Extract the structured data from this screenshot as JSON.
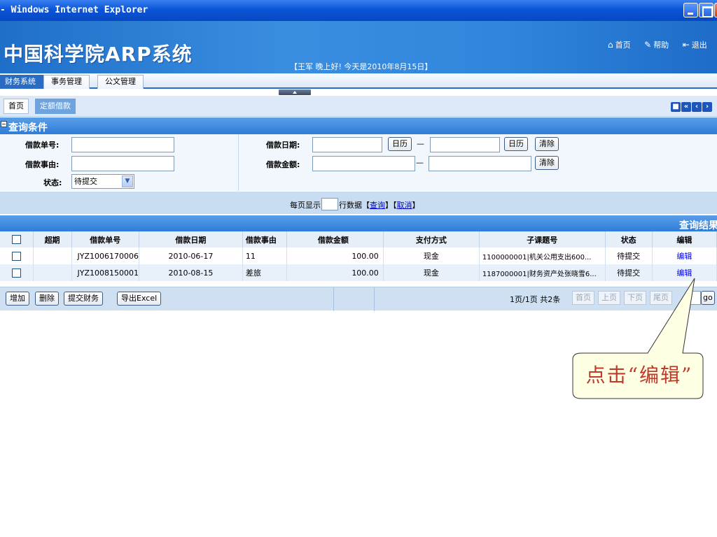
{
  "window": {
    "title": "- Windows Internet Explorer"
  },
  "banner": {
    "logo": "中国科学院ARP系统",
    "greeting": "【王军 晚上好! 今天是2010年8月15日】",
    "links": [
      {
        "icon": "home-icon",
        "glyph": "⌂",
        "label": "首页"
      },
      {
        "icon": "help-icon",
        "glyph": "✎",
        "label": "帮助"
      },
      {
        "icon": "logout-icon",
        "glyph": "⇤",
        "label": "退出"
      }
    ]
  },
  "menu": {
    "tabs": [
      "财务系统",
      "事务管理",
      "公文管理"
    ],
    "active": 0
  },
  "page_tabs": {
    "home": "首页",
    "current": "定额借款"
  },
  "query": {
    "section_title": "查询条件",
    "loan_no_label": "借款单号:",
    "loan_reason_label": "借款事由:",
    "status_label": "状态:",
    "status_value": "待提交",
    "loan_date_label": "借款日期:",
    "loan_amount_label": "借款金额:",
    "calendar_btn": "日历",
    "clear_btn": "清除",
    "range_sep": "—"
  },
  "paging": {
    "prefix": "每页显示",
    "suffix": "行数据【",
    "query_link": "查询",
    "mid": "】【",
    "cancel_link": "取消",
    "end": "】"
  },
  "results": {
    "section_title": "查询结果",
    "columns": [
      "",
      "超期",
      "借款单号",
      "借款日期",
      "借款事由",
      "借款金额",
      "支付方式",
      "子课题号",
      "状态",
      "编辑"
    ],
    "rows": [
      {
        "overdue": "",
        "loan_no": "JYZ1006170006",
        "date": "2010-06-17",
        "reason": "11",
        "amount": "100.00",
        "pay": "现金",
        "subject": "1100000001|机关公用支出600...",
        "status": "待提交",
        "edit": "编辑"
      },
      {
        "overdue": "",
        "loan_no": "JYZ1008150001",
        "date": "2010-08-15",
        "reason": "差旅",
        "amount": "100.00",
        "pay": "现金",
        "subject": "1187000001|财务资产处张晓雪6...",
        "status": "待提交",
        "edit": "编辑"
      }
    ]
  },
  "footer": {
    "buttons": [
      "增加",
      "删除",
      "提交财务",
      "导出Excel"
    ],
    "page_info": "1页/1页 共2条",
    "nav": [
      "首页",
      "上页",
      "下页",
      "尾页"
    ],
    "go": "go"
  },
  "callout": {
    "text": "点击“编辑”"
  }
}
